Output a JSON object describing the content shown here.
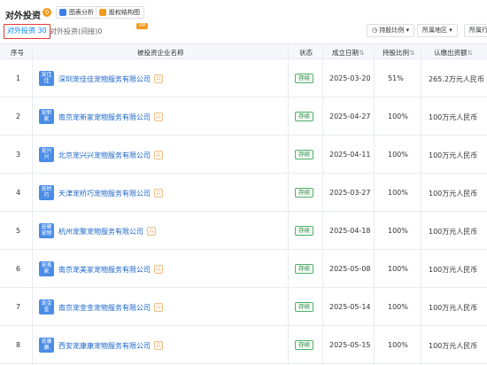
{
  "header": {
    "title": "对外投资",
    "title_badge": "0",
    "chart_btn": "图表分析",
    "structure_btn": "股权结构图"
  },
  "tabs": {
    "active_label": "对外投资",
    "active_count": "30",
    "indirect_label": "对外投资(间接)",
    "indirect_count": "0",
    "indirect_badge": "VIP"
  },
  "filters": {
    "ratio": "持股比例",
    "region": "所属地区",
    "industry": "所属行业"
  },
  "table": {
    "headers": [
      "序号",
      "被投资企业名称",
      "状态",
      "成立日期",
      "持股比例",
      "认缴出资额"
    ],
    "sort_glyph": "⇅",
    "rows": [
      {
        "no": "1",
        "logo": "宠佳佳",
        "name": "深圳宠佳佳宠物服务有限公司",
        "status": "存续",
        "date": "2025-03-20",
        "ratio": "51%",
        "capital": "265.2万元人民币"
      },
      {
        "no": "2",
        "logo": "宠新家",
        "name": "南京宠新家宠物服务有限公司",
        "status": "存续",
        "date": "2025-04-27",
        "ratio": "100%",
        "capital": "100万元人民币"
      },
      {
        "no": "3",
        "logo": "宠兴兴",
        "name": "北京宠兴兴宠物服务有限公司",
        "status": "存续",
        "date": "2025-04-11",
        "ratio": "100%",
        "capital": "100万元人民币"
      },
      {
        "no": "4",
        "logo": "宠桥巧",
        "name": "天津宠桥巧宠物服务有限公司",
        "status": "存续",
        "date": "2025-03-27",
        "ratio": "100%",
        "capital": "100万元人民币"
      },
      {
        "no": "5",
        "logo": "宠聚宠物",
        "name": "杭州宠聚宠物服务有限公司",
        "status": "存续",
        "date": "2025-04-18",
        "ratio": "100%",
        "capital": "100万元人民币"
      },
      {
        "no": "6",
        "logo": "宠美家",
        "name": "南京宠美家宠物服务有限公司",
        "status": "存续",
        "date": "2025-05-08",
        "ratio": "100%",
        "capital": "100万元人民币"
      },
      {
        "no": "7",
        "logo": "宠金金",
        "name": "南京宠金金宠物服务有限公司",
        "status": "存续",
        "date": "2025-05-14",
        "ratio": "100%",
        "capital": "100万元人民币"
      },
      {
        "no": "8",
        "logo": "宠康康",
        "name": "西安宠康康宠物服务有限公司",
        "status": "存续",
        "date": "2025-05-15",
        "ratio": "100%",
        "capital": "100万元人民币"
      }
    ]
  },
  "colors": {
    "link": "#1b65c9",
    "logo_bg": "#4a8de8",
    "status": "#2e8b44",
    "active_tab_border": "#e53935"
  }
}
